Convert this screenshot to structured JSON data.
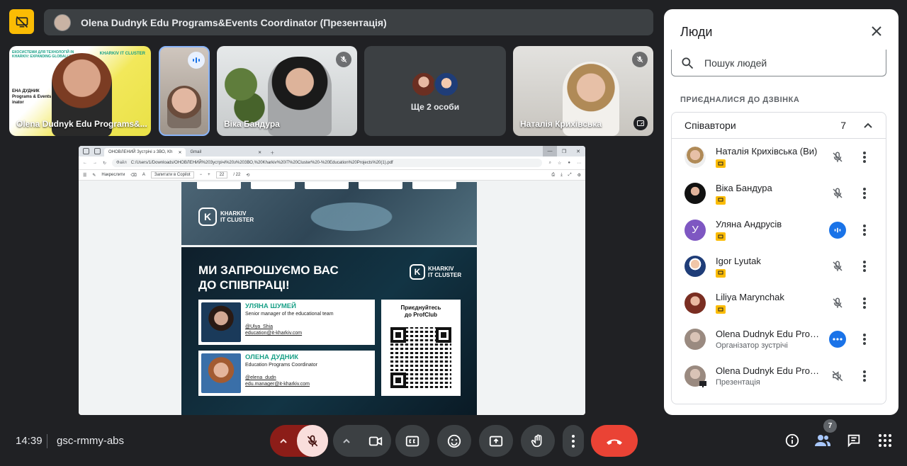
{
  "presentation_bar": {
    "title": "Olena Dudnyk Edu Programs&Events Coordinator (Презентація)"
  },
  "tiles": [
    {
      "name": "Olena Dudnyk Edu Programs&...",
      "slide_top_text": "ЕКОСИСТЕМИ ДЛЯ ТЕХНОЛОГІЙ IN KHARKIV: EXPANDING GLOBALLY",
      "slide_side_text": "ЕНА ДУДНИК",
      "slide_side_text2": "Programs & Events",
      "slide_side_text3": "inator",
      "slide_logo": "KHARKIV IT CLUSTER"
    },
    {
      "name": ""
    },
    {
      "name": "Віка Бандура"
    },
    {
      "name": "Ще 2 особи"
    },
    {
      "name": "Наталія Крихівська"
    }
  ],
  "browser": {
    "tabs": [
      {
        "label": "ОНОВЛЕНИЙ Зустрічі з ЗВО, Kh",
        "active": true
      },
      {
        "label": "Gmail",
        "active": false
      }
    ],
    "file_label": "Файл",
    "url": "C:/Users/1/Downloads/ОНОВЛЕНИЙ%20Зустрічі%20з%20ЗВО,%20Kharkiv%20IT%20Cluster%20-%20Education%20Projects%20(1).pdf",
    "pdf_toolbar": {
      "draw_label": "Накреслити",
      "copilot_label": "Запитати в Copilot",
      "page_current": "22",
      "page_total": "/ 22"
    }
  },
  "slide": {
    "brand_line1": "KHARKIV",
    "brand_line2": "IT CLUSTER",
    "heading_line1": "МИ ЗАПРОШУЄМО ВАС",
    "heading_line2": "ДО СПІВПРАЦІ!",
    "contacts": [
      {
        "name": "УЛЯНА ШУМЕЙ",
        "role": "Senior manager of the educational team",
        "handle": "@Ulya_Shia",
        "email": "education@it-kharkiv.com"
      },
      {
        "name": "ОЛЕНА ДУДНИК",
        "role": "Education Programs Coordinator",
        "handle": "@elena_dudn",
        "email": "edu.manager@it-kharkiv.com"
      }
    ],
    "qr_line1": "Приєднуйтесь",
    "qr_line2": "до ProfClub"
  },
  "people_panel": {
    "title": "Люди",
    "search_placeholder": "Пошук людей",
    "section_label": "ПРИЄДНАЛИСЯ ДО ДЗВІНКА",
    "group_label": "Співавтори",
    "group_count": "7",
    "participants": [
      {
        "name": "Наталія Крихівська (Ви)",
        "subtitle": "",
        "status": "muted"
      },
      {
        "name": "Віка Бандура",
        "subtitle": "",
        "status": "muted"
      },
      {
        "name": "Уляна Андрусів",
        "subtitle": "",
        "status": "speaking",
        "initial": "У"
      },
      {
        "name": "Igor Lyutak",
        "subtitle": "",
        "status": "muted"
      },
      {
        "name": "Liliya Marynchak",
        "subtitle": "",
        "status": "muted"
      },
      {
        "name": "Olena Dudnyk Edu Prog...",
        "subtitle": "Організатор зустрічі",
        "status": "more"
      },
      {
        "name": "Olena Dudnyk Edu Prog...",
        "subtitle": "Презентація",
        "status": "audio-off"
      }
    ]
  },
  "bottom_bar": {
    "time": "14:39",
    "meeting_code": "gsc-rmmy-abs",
    "people_count": "7"
  },
  "colors": {
    "accent_red": "#ea4335",
    "present_yellow": "#fbbc04",
    "speaking_blue": "#1a73e8",
    "brand_green": "#19a087"
  }
}
